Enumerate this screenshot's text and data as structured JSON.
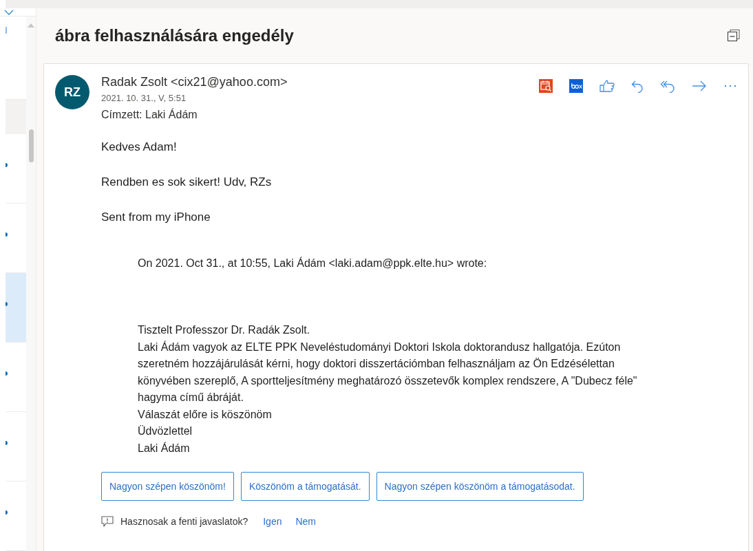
{
  "subject": "ábra felhasználására engedély",
  "message": {
    "avatar": "RZ",
    "sender": "Radak Zsolt <cix21@yahoo.com>",
    "date": "2021. 10. 31., V, 5:51",
    "to_label": "Címzett:",
    "to": "Laki Ádám",
    "body": [
      "Kedves Adam!",
      "Rendben es sok sikert! Udv, RZs",
      "Sent from my iPhone"
    ],
    "quote_header": "On 2021. Oct 31., at 10:55, Laki Ádám <laki.adam@ppk.elte.hu> wrote:",
    "quote_lines": [
      "Tisztelt Professzor Dr. Radák Zsolt.",
      "Laki Ádám vagyok az ELTE PPK Neveléstudományi Doktori Iskola doktorandusz hallgatója. Ezúton szeretném hozzájárulását kérni, hogy doktori disszertációmban felhasználjam az Ön Edzésélettan könyvében szereplő,  A sportteljesítmény meghatározó összetevők komplex rendszere, A \"Dubecz féle\" hagyma című ábráját.",
      "Válaszát előre is köszönöm",
      "Üdvözlettel",
      "Laki Ádám"
    ]
  },
  "suggested_replies": [
    "Nagyon szépen köszönöm!",
    "Köszönöm a támogatását.",
    "Nagyon szépen köszönöm a támogatásodat."
  ],
  "feedback": {
    "question": "Hasznosak a fenti javaslatok?",
    "yes": "Igen",
    "no": "Nem"
  },
  "list_rows": [
    {
      "selected": false
    },
    {
      "selected": false
    },
    {
      "selected": true
    },
    {
      "selected": false
    },
    {
      "selected": false
    },
    {
      "selected": false
    }
  ]
}
